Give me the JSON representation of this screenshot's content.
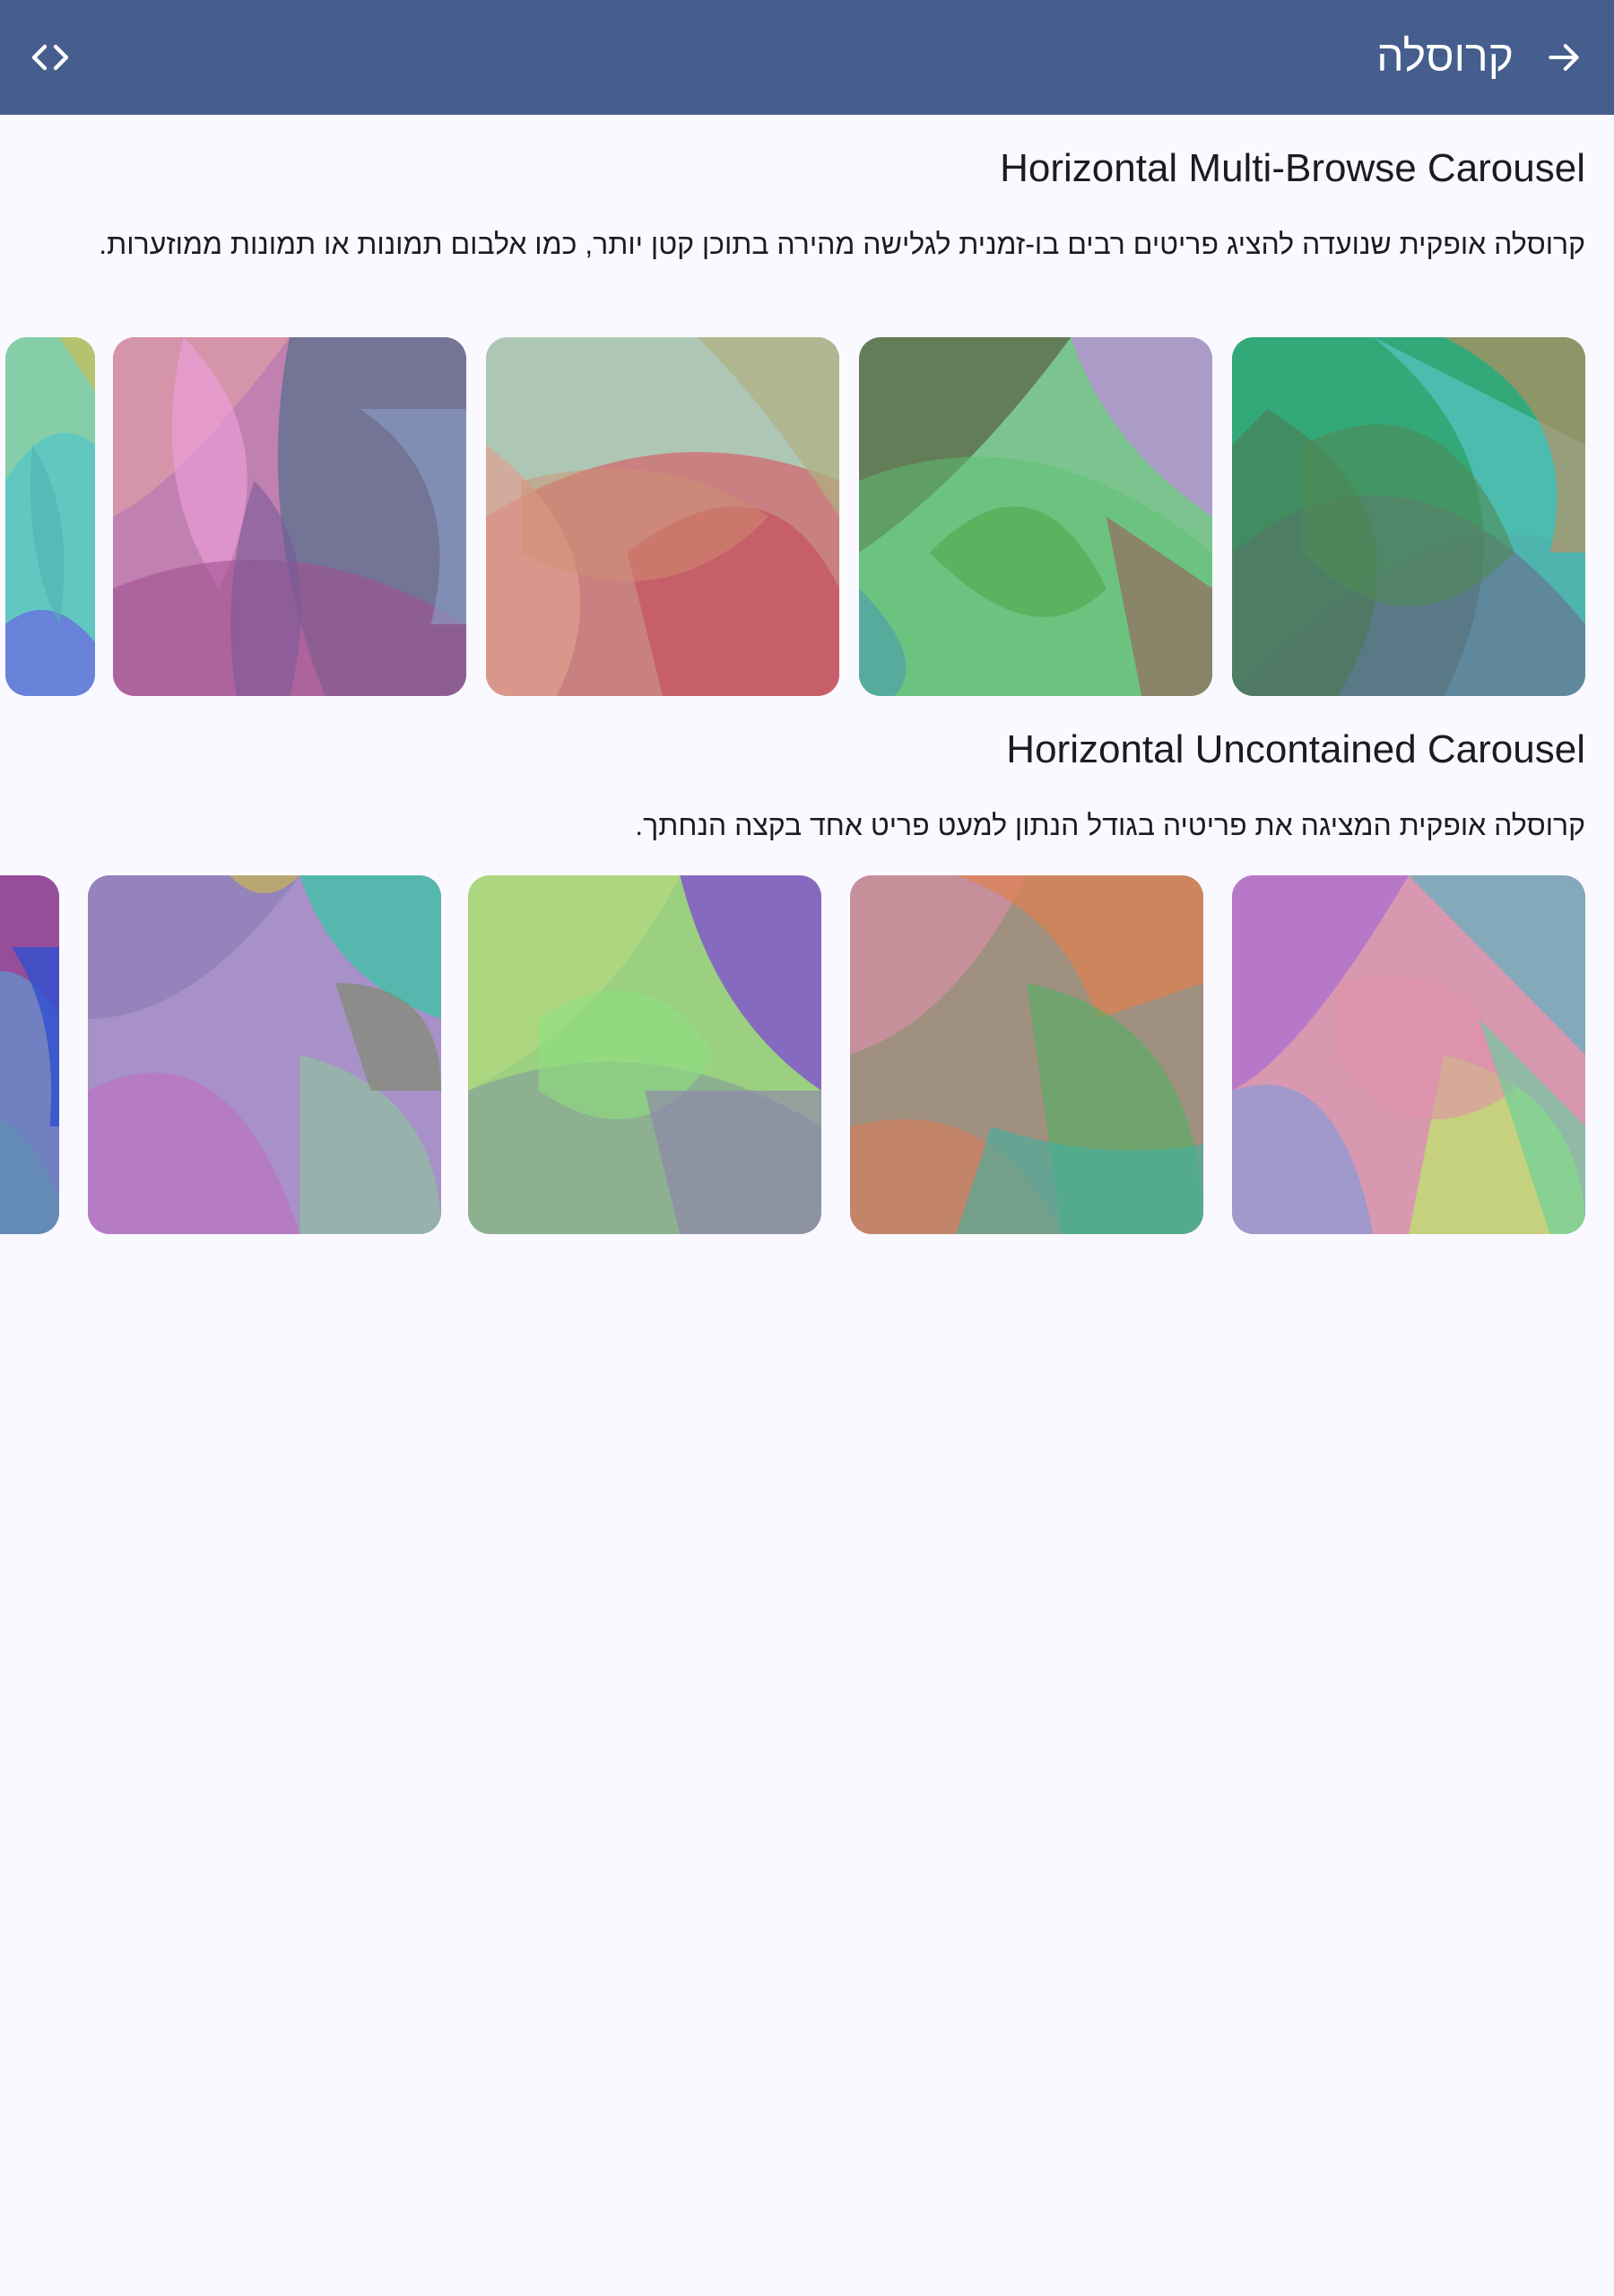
{
  "appbar": {
    "title": "קרוסלה",
    "back_icon": "arrow-forward-icon",
    "code_icon": "code-icon",
    "bg_color": "#455e8d"
  },
  "sections": [
    {
      "title": "Horizontal Multi-Browse Carousel",
      "description": "קרוסלה אופקית שנועדה להציג פריטים רבים בו-זמנית לגלישה מהירה בתוכן קטן יותר, כמו אלבום תמונות או תמונות ממוזערות."
    },
    {
      "title": "Horizontal Uncontained Carousel",
      "description": "קרוסלה אופקית המציגה את פריטיה בגודל הנתון למעט פריט אחד בקצה הנחתך."
    }
  ]
}
